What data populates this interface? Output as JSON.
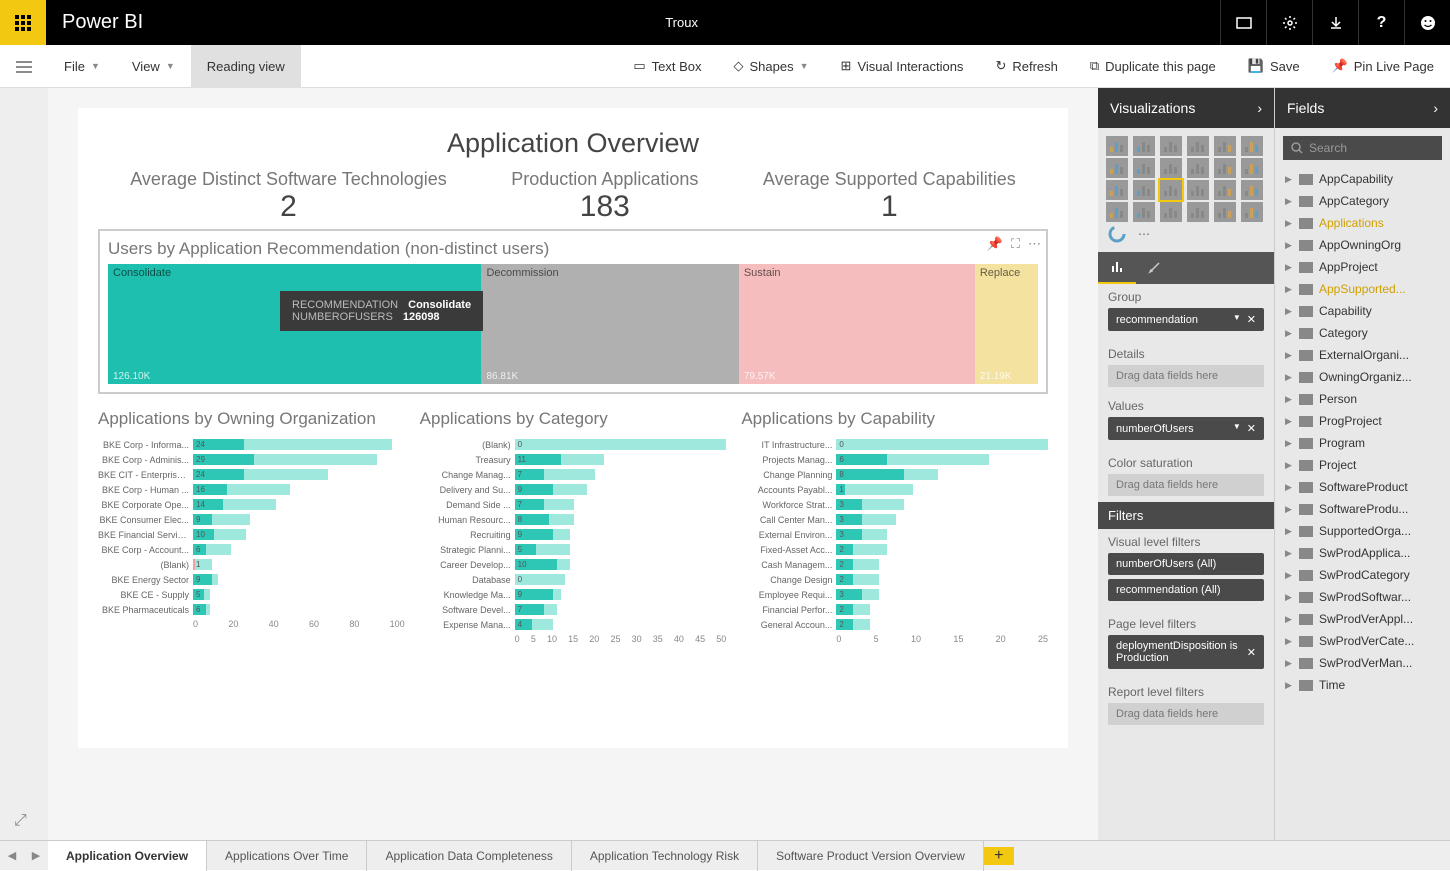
{
  "app": {
    "name": "Power BI",
    "doc_title": "Troux"
  },
  "toolbar": {
    "file": "File",
    "view": "View",
    "reading": "Reading view",
    "textbox": "Text Box",
    "shapes": "Shapes",
    "interactions": "Visual Interactions",
    "refresh": "Refresh",
    "duplicate": "Duplicate this page",
    "save": "Save",
    "pin": "Pin Live Page"
  },
  "report": {
    "title": "Application Overview",
    "kpis": [
      {
        "label": "Average Distinct Software Technologies",
        "value": "2"
      },
      {
        "label": "Production Applications",
        "value": "183"
      },
      {
        "label": "Average Supported Capabilities",
        "value": "1"
      }
    ],
    "treemap": {
      "title": "Users by Application Recommendation (non-distinct users)",
      "tooltip": {
        "rec_label": "RECOMMENDATION",
        "rec_value": "Consolidate",
        "num_label": "NUMBEROFUSERS",
        "num_value": "126098"
      }
    },
    "charts": {
      "owning": "Applications by Owning Organization",
      "category": "Applications by Category",
      "capability": "Applications by Capability"
    }
  },
  "chart_data": {
    "treemap": {
      "type": "treemap",
      "series": [
        {
          "name": "Consolidate",
          "value": 126098,
          "label": "126.10K",
          "color": "#1EBFAE"
        },
        {
          "name": "Decommission",
          "value": 86810,
          "label": "86.81K",
          "color": "#B0B0B0"
        },
        {
          "name": "Sustain",
          "value": 79570,
          "label": "79.57K",
          "color": "#F5BDBD"
        },
        {
          "name": "Replace",
          "value": 21190,
          "label": "21.19K",
          "color": "#F3E2A0"
        }
      ]
    },
    "owning": {
      "type": "bar",
      "xlim": [
        0,
        100
      ],
      "ticks": [
        0,
        20,
        40,
        60,
        80,
        100
      ],
      "data": [
        {
          "label": "BKE Corp - Informa...",
          "value": 24,
          "extra": 70
        },
        {
          "label": "BKE Corp - Adminis...",
          "value": 29,
          "extra": 58
        },
        {
          "label": "BKE CIT - Enterprise...",
          "value": 24,
          "extra": 40
        },
        {
          "label": "BKE Corp - Human ...",
          "value": 16,
          "extra": 30
        },
        {
          "label": "BKE Corporate Ope...",
          "value": 14,
          "extra": 25
        },
        {
          "label": "BKE Consumer Elec...",
          "value": 9,
          "extra": 18
        },
        {
          "label": "BKE Financial Servic...",
          "value": 10,
          "extra": 15
        },
        {
          "label": "BKE Corp - Account...",
          "value": 6,
          "extra": 12
        },
        {
          "label": "(Blank)",
          "value": 1,
          "pink": true,
          "extra": 8
        },
        {
          "label": "BKE Energy Sector",
          "value": 9,
          "extra": 3
        },
        {
          "label": "BKE CE - Supply",
          "value": 5,
          "extra": 3
        },
        {
          "label": "BKE Pharmaceuticals",
          "value": 6,
          "extra": 2
        }
      ]
    },
    "category": {
      "type": "bar",
      "xlim": [
        0,
        50
      ],
      "ticks": [
        0,
        5,
        10,
        15,
        20,
        25,
        30,
        35,
        40,
        45,
        50
      ],
      "data": [
        {
          "label": "(Blank)",
          "value": 0,
          "pink": true,
          "extra": 50
        },
        {
          "label": "Treasury",
          "value": 11,
          "extra": 10
        },
        {
          "label": "Change Manag...",
          "value": 7,
          "extra": 12
        },
        {
          "label": "Delivery and Su...",
          "value": 9,
          "extra": 8
        },
        {
          "label": "Demand Side ...",
          "value": 7,
          "extra": 7
        },
        {
          "label": "Human Resourc...",
          "value": 8,
          "extra": 6
        },
        {
          "label": "Recruiting",
          "value": 9,
          "extra": 4
        },
        {
          "label": "Strategic Planni...",
          "value": 5,
          "extra": 8
        },
        {
          "label": "Career Develop...",
          "value": 10,
          "extra": 3
        },
        {
          "label": "Database",
          "value": 0,
          "extra": 12
        },
        {
          "label": "Knowledge Ma...",
          "value": 9,
          "extra": 2
        },
        {
          "label": "Software Devel...",
          "value": 7,
          "extra": 3
        },
        {
          "label": "Expense Mana...",
          "value": 4,
          "extra": 5
        }
      ]
    },
    "capability": {
      "type": "bar",
      "xlim": [
        0,
        25
      ],
      "ticks": [
        0,
        5,
        10,
        15,
        20,
        25
      ],
      "data": [
        {
          "label": "IT Infrastructure...",
          "value": 0,
          "extra": 25
        },
        {
          "label": "Projects Manag...",
          "value": 6,
          "extra": 12
        },
        {
          "label": "Change Planning",
          "value": 8,
          "extra": 4
        },
        {
          "label": "Accounts Payabl...",
          "value": 1,
          "extra": 8
        },
        {
          "label": "Workforce Strat...",
          "value": 3,
          "extra": 5
        },
        {
          "label": "Call Center Man...",
          "value": 3,
          "extra": 4
        },
        {
          "label": "External Environ...",
          "value": 3,
          "extra": 3
        },
        {
          "label": "Fixed-Asset Acc...",
          "value": 2,
          "extra": 4
        },
        {
          "label": "Cash Managem...",
          "value": 2,
          "extra": 3
        },
        {
          "label": "Change Design",
          "value": 2,
          "extra": 3
        },
        {
          "label": "Employee Requi...",
          "value": 3,
          "extra": 2
        },
        {
          "label": "Financial Perfor...",
          "value": 2,
          "extra": 2
        },
        {
          "label": "General Accoun...",
          "value": 2,
          "extra": 2
        }
      ]
    }
  },
  "viz": {
    "header": "Visualizations",
    "group_label": "Group",
    "group_field": "recommendation",
    "details_label": "Details",
    "details_placeholder": "Drag data fields here",
    "values_label": "Values",
    "values_field": "numberOfUsers",
    "color_label": "Color saturation",
    "color_placeholder": "Drag data fields here",
    "filters_header": "Filters",
    "visual_filters_label": "Visual level filters",
    "filter1": "numberOfUsers (All)",
    "filter2": "recommendation (All)",
    "page_filters_label": "Page level filters",
    "page_filter": "deploymentDisposition is Production",
    "report_filters_label": "Report level filters",
    "report_placeholder": "Drag data fields here"
  },
  "fields": {
    "header": "Fields",
    "search_placeholder": "Search",
    "items": [
      {
        "name": "AppCapability"
      },
      {
        "name": "AppCategory"
      },
      {
        "name": "Applications",
        "hl": true
      },
      {
        "name": "AppOwningOrg"
      },
      {
        "name": "AppProject"
      },
      {
        "name": "AppSupported...",
        "hl": true
      },
      {
        "name": "Capability"
      },
      {
        "name": "Category"
      },
      {
        "name": "ExternalOrgani..."
      },
      {
        "name": "OwningOrganiz..."
      },
      {
        "name": "Person"
      },
      {
        "name": "ProgProject"
      },
      {
        "name": "Program"
      },
      {
        "name": "Project"
      },
      {
        "name": "SoftwareProduct"
      },
      {
        "name": "SoftwareProdu..."
      },
      {
        "name": "SupportedOrga..."
      },
      {
        "name": "SwProdApplica..."
      },
      {
        "name": "SwProdCategory"
      },
      {
        "name": "SwProdSoftwar..."
      },
      {
        "name": "SwProdVerAppl..."
      },
      {
        "name": "SwProdVerCate..."
      },
      {
        "name": "SwProdVerMan..."
      },
      {
        "name": "Time"
      }
    ]
  },
  "pages": {
    "tabs": [
      "Application Overview",
      "Applications Over Time",
      "Application Data Completeness",
      "Application Technology Risk",
      "Software Product Version Overview"
    ]
  }
}
